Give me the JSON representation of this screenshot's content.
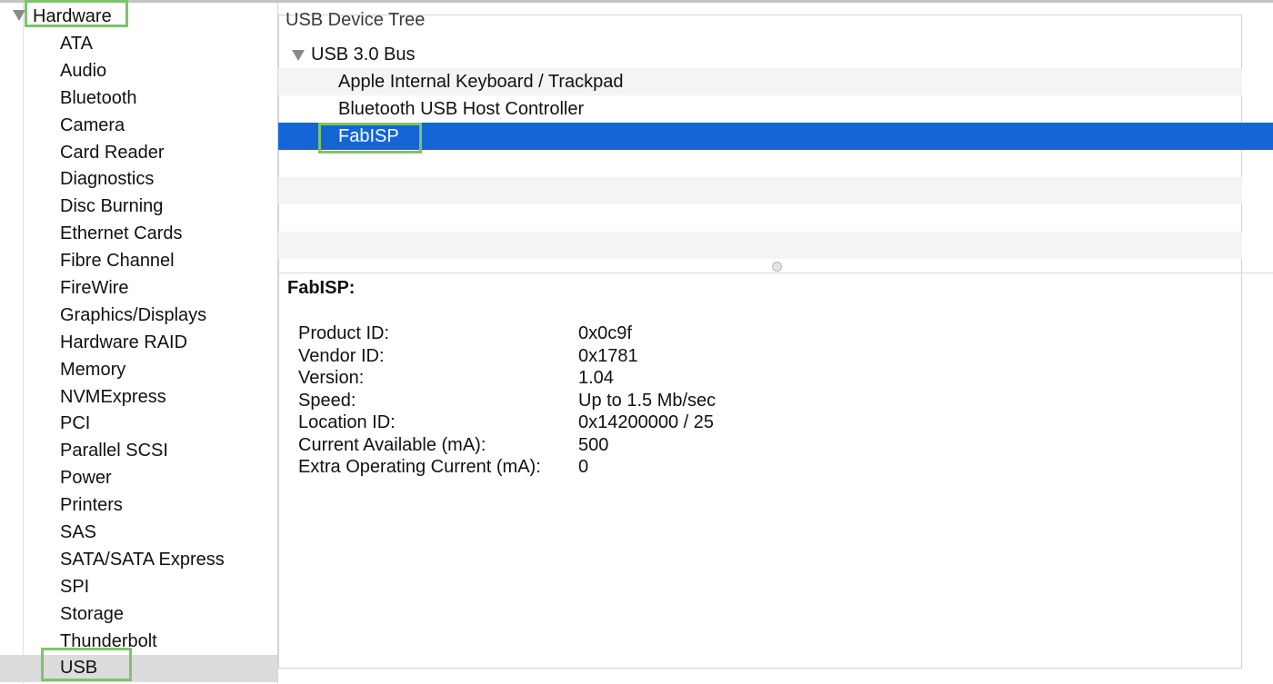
{
  "sidebar": {
    "section_label": "Hardware",
    "items": [
      {
        "label": "ATA"
      },
      {
        "label": "Audio"
      },
      {
        "label": "Bluetooth"
      },
      {
        "label": "Camera"
      },
      {
        "label": "Card Reader"
      },
      {
        "label": "Diagnostics"
      },
      {
        "label": "Disc Burning"
      },
      {
        "label": "Ethernet Cards"
      },
      {
        "label": "Fibre Channel"
      },
      {
        "label": "FireWire"
      },
      {
        "label": "Graphics/Displays"
      },
      {
        "label": "Hardware RAID"
      },
      {
        "label": "Memory"
      },
      {
        "label": "NVMExpress"
      },
      {
        "label": "PCI"
      },
      {
        "label": "Parallel SCSI"
      },
      {
        "label": "Power"
      },
      {
        "label": "Printers"
      },
      {
        "label": "SAS"
      },
      {
        "label": "SATA/SATA Express"
      },
      {
        "label": "SPI"
      },
      {
        "label": "Storage"
      },
      {
        "label": "Thunderbolt"
      },
      {
        "label": "USB"
      }
    ],
    "selected": "USB"
  },
  "tree": {
    "header": "USB Device Tree",
    "bus": "USB 3.0 Bus",
    "devices": [
      {
        "label": "Apple Internal Keyboard / Trackpad"
      },
      {
        "label": "Bluetooth USB Host Controller"
      },
      {
        "label": "FabISP"
      }
    ],
    "selected": "FabISP"
  },
  "detail": {
    "title": "FabISP:",
    "rows": [
      {
        "key": "Product ID:",
        "value": "0x0c9f"
      },
      {
        "key": "Vendor ID:",
        "value": "0x1781"
      },
      {
        "key": "Version:",
        "value": "1.04"
      },
      {
        "key": "Speed:",
        "value": "Up to 1.5 Mb/sec"
      },
      {
        "key": "Location ID:",
        "value": "0x14200000 / 25"
      },
      {
        "key": "Current Available (mA):",
        "value": "500"
      },
      {
        "key": "Extra Operating Current (mA):",
        "value": "0"
      }
    ]
  },
  "colors": {
    "selection": "#1565d7",
    "annotation_highlight": "#7dc36b",
    "sidebar_selected": "#dcdcdc"
  }
}
